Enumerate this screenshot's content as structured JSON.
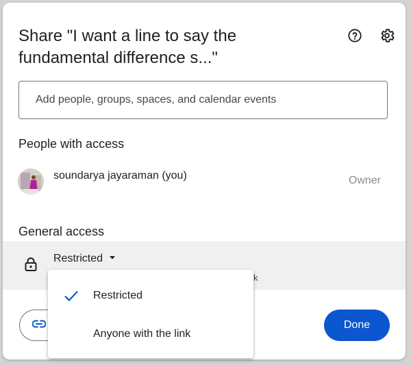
{
  "dialog": {
    "title": "Share \"I want a line to say the fundamental difference s...\"",
    "help_icon": "help-circle-icon",
    "settings_icon": "gear-icon"
  },
  "search": {
    "placeholder": "Add people, groups, spaces, and calendar events",
    "value": ""
  },
  "people": {
    "section_title": "People with access",
    "items": [
      {
        "name": "soundarya jayaraman (you)",
        "role": "Owner"
      }
    ]
  },
  "general_access": {
    "section_title": "General access",
    "selected": "Restricted",
    "description_tail": "k",
    "options": [
      {
        "label": "Restricted",
        "checked": true
      },
      {
        "label": "Anyone with the link",
        "checked": false
      }
    ]
  },
  "footer": {
    "copy_link_icon": "link-icon",
    "done_label": "Done"
  },
  "colors": {
    "primary": "#0b57d0",
    "text": "#1f1f1f",
    "muted": "#8c8c8c",
    "band": "#f0f0f0",
    "backdrop": "#d3d3d3"
  }
}
